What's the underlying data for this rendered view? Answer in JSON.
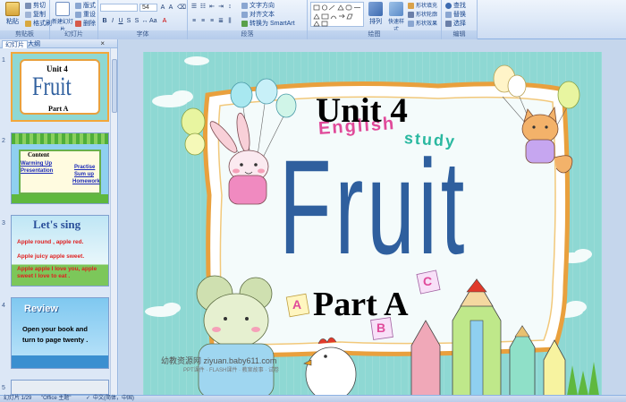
{
  "ribbon": {
    "clipboard": {
      "label": "剪贴板",
      "paste": "粘贴",
      "cut": "剪切",
      "copy": "复制",
      "format_painter": "格式刷"
    },
    "slides": {
      "label": "幻灯片",
      "new_slide": "新建幻灯片",
      "layout": "版式",
      "reset": "重设",
      "delete": "删除"
    },
    "font": {
      "label": "字体",
      "font_size": "54"
    },
    "paragraph": {
      "label": "段落",
      "text_direction": "文字方向",
      "align_text": "对齐文本",
      "smartart": "转换为 SmartArt"
    },
    "drawing": {
      "label": "绘图",
      "arrange": "排列",
      "quick_styles": "快速样式",
      "shape_fill": "形状填充",
      "shape_outline": "形状轮廓",
      "shape_effects": "形状效果"
    },
    "editing": {
      "label": "编辑",
      "find": "查找",
      "replace": "替换",
      "select": "选择"
    }
  },
  "panel": {
    "tabs": [
      "幻灯片",
      "大纲"
    ],
    "close": "×",
    "thumbs": [
      {
        "num": "1",
        "unit": "Unit 4",
        "title": "Fruit",
        "part": "Part A"
      },
      {
        "num": "2",
        "heading": "Content",
        "items_left": [
          "Warming Up",
          "Presentation"
        ],
        "items_right": [
          "Practise",
          "Sum up",
          "Homework"
        ]
      },
      {
        "num": "3",
        "heading": "Let's sing",
        "lines": [
          "Apple round , apple red.",
          "Apple juicy apple sweet.",
          "Apple apple I love you, apple sweet I love to eat ."
        ]
      },
      {
        "num": "4",
        "heading": "Review",
        "lines": [
          "Open your book and",
          "turn to page twenty ."
        ]
      },
      {
        "num": "5"
      }
    ]
  },
  "slide": {
    "unit": "Unit 4",
    "title": "Fruit",
    "part": "Part A",
    "deco_english": "English",
    "deco_study": "study",
    "blocks": [
      "A",
      "B",
      "C"
    ],
    "watermark": "幼教资源网 ziyuan.baby611.com",
    "watermark_sub": "PPT课件 · FLASH课件 · 教案故事 · 试卷"
  },
  "status": {
    "slide_count": "幻灯片 1/29",
    "theme": "\"Office 主题\"",
    "language": "中文(简体，中国)"
  },
  "colors": {
    "title_blue": "#2f5f9e",
    "slide_bg": "#8ed8d3",
    "frame_orange": "#e9a03d"
  }
}
